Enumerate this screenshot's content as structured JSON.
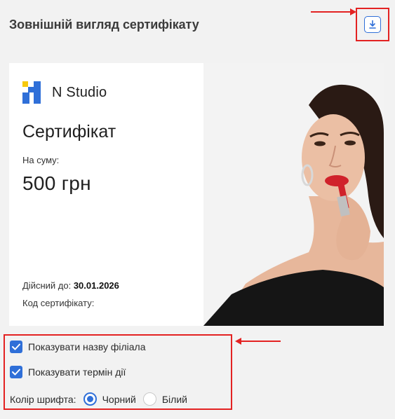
{
  "header": {
    "title": "Зовнішній вигляд сертифікату",
    "download_icon": "download-icon"
  },
  "certificate": {
    "brand_name": "N Studio",
    "title": "Сертифікат",
    "sum_label": "На суму:",
    "sum_value": "500 грн",
    "valid_label": "Дійсний до:",
    "valid_date": "30.01.2026",
    "code_label": "Код сертифікату:"
  },
  "options": {
    "show_branch_label": "Показувати назву філіала",
    "show_branch_checked": true,
    "show_expiry_label": "Показувати термін дії",
    "show_expiry_checked": true,
    "font_color_label": "Колір шрифта:",
    "font_color_options": [
      "Чорний",
      "Білий"
    ],
    "font_color_selected": "Чорний"
  },
  "colors": {
    "accent": "#2f6fd8",
    "annotation": "#e32222",
    "background": "#f2f2f2"
  }
}
